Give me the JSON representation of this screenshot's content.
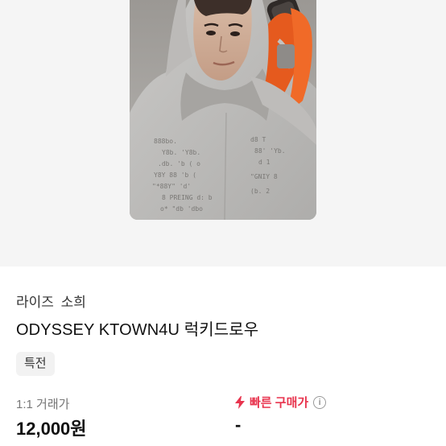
{
  "product": {
    "artist": "라이즈",
    "member": "소희",
    "title": "ODYSSEY KTOWN4U 럭키드로우",
    "tag": "특전"
  },
  "pricing": {
    "label": "1:1 거래가",
    "value": "12,000원",
    "fast_label": "빠른 구매가",
    "fast_value": "-",
    "info_icon": "i"
  },
  "colors": {
    "accent": "#e8344e"
  }
}
